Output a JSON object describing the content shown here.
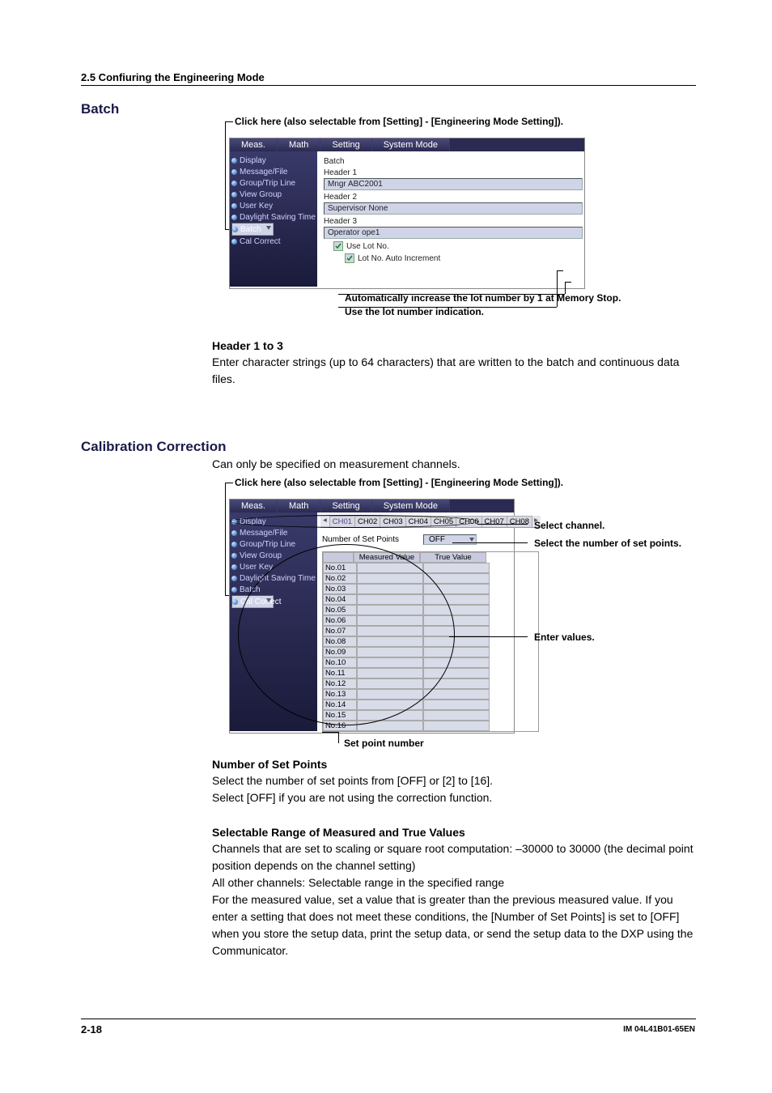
{
  "header": {
    "section": "2.5  Confiuring the Engineering Mode"
  },
  "batch": {
    "title": "Batch",
    "caption": "Click here (also selectable from [Setting] - [Engineering Mode Setting]).",
    "menu": {
      "meas": "Meas.",
      "math": "Math",
      "setting": "Setting",
      "system": "System Mode"
    },
    "tree": {
      "display": "Display",
      "message": "Message/File",
      "group": "Group/Trip Line",
      "viewgroup": "View Group",
      "userkey": "User Key",
      "dst": "Daylight Saving Time",
      "batch": "Batch",
      "cal": "Cal Correct"
    },
    "detail": {
      "title": "Batch",
      "h1": "Header 1",
      "v1": "Mngr ABC2001",
      "h2": "Header 2",
      "v2": "Supervisor None",
      "h3": "Header 3",
      "v3": "Operator ope1",
      "useLot": "Use Lot No.",
      "autoInc": "Lot No. Auto Increment"
    },
    "anno": {
      "autoInc": "Automatically increase the lot number by 1 at Memory Stop.",
      "useLot": "Use the lot number indication."
    },
    "sub": {
      "title": "Header 1 to 3",
      "text": "Enter character strings (up to 64 characters) that are written to the batch and continuous data files."
    }
  },
  "cal": {
    "title": "Calibration Correction",
    "intro": "Can only be specified on measurement channels.",
    "caption": "Click here (also selectable from [Setting] - [Engineering Mode Setting]).",
    "menu": {
      "meas": "Meas.",
      "math": "Math",
      "setting": "Setting",
      "system": "System Mode"
    },
    "tree": {
      "display": "Display",
      "message": "Message/File",
      "group": "Group/Trip Line",
      "viewgroup": "View Group",
      "userkey": "User Key",
      "dst": "Daylight Saving Time",
      "batch": "Batch",
      "cal": "Cal Correct"
    },
    "tabs": [
      "CH01",
      "CH02",
      "CH03",
      "CH04",
      "CH05",
      "CH06",
      "CH07",
      "CH08"
    ],
    "nsp_label": "Number of Set Points",
    "nsp_value": "OFF",
    "tbl_headers": {
      "mv": "Measured Value",
      "tv": "True Value"
    },
    "rows": [
      "No.01",
      "No.02",
      "No.03",
      "No.04",
      "No.05",
      "No.06",
      "No.07",
      "No.08",
      "No.09",
      "No.10",
      "No.11",
      "No.12",
      "No.13",
      "No.14",
      "No.15",
      "No.16"
    ],
    "anno": {
      "setpoint": "Set point number",
      "selch": "Select channel.",
      "selnsp": "Select the number of set points.",
      "enter": "Enter values."
    },
    "nsp": {
      "title": "Number of Set Points",
      "text": "Select the number of set points from [OFF] or [2] to [16].\nSelect [OFF] if you are not using the correction function."
    },
    "srange": {
      "title": "Selectable Range of Measured and True Values",
      "text": "Channels that are set to scaling or square root computation: –30000 to 30000 (the decimal point position depends on the channel setting)\nAll other channels: Selectable range in the specified range\nFor the measured value, set a value that is greater than the previous measured value. If you enter a setting that does not meet these conditions, the [Number of Set Points] is set to [OFF] when you store the setup data, print the setup data, or send the setup data to the DXP using the Communicator."
    }
  },
  "footer": {
    "page": "2-18",
    "doc": "IM 04L41B01-65EN"
  }
}
